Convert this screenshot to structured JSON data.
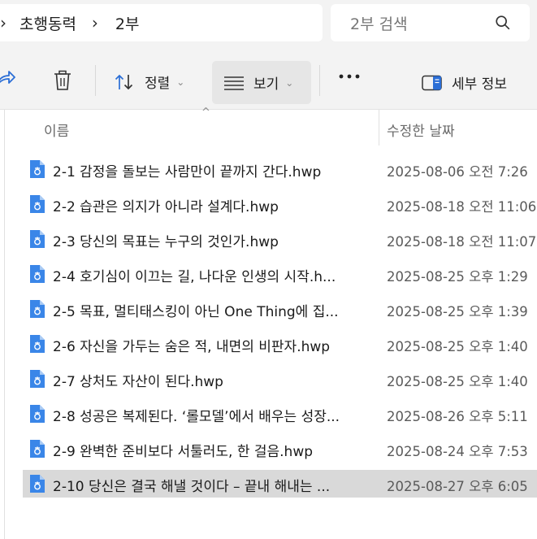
{
  "address": {
    "crumbs": [
      "초행동력",
      "2부"
    ]
  },
  "search": {
    "placeholder": "2부 검색"
  },
  "toolbar": {
    "sort_label": "정렬",
    "view_label": "보기",
    "details_label": "세부 정보"
  },
  "columns": {
    "name": "이름",
    "modified": "수정한 날짜"
  },
  "files": [
    {
      "name": "2-1 감정을 돌보는 사람만이 끝까지 간다.hwp",
      "modified": "2025-08-06 오전 7:26"
    },
    {
      "name": "2-2 습관은 의지가 아니라 설계다.hwp",
      "modified": "2025-08-18 오전 11:06"
    },
    {
      "name": "2-3 당신의 목표는 누구의 것인가.hwp",
      "modified": "2025-08-18 오전 11:07"
    },
    {
      "name": "2-4 호기심이 이끄는 길, 나다운 인생의 시작.h...",
      "modified": "2025-08-25 오후 1:29"
    },
    {
      "name": "2-5 목표, 멀티태스킹이 아닌 One Thing에 집...",
      "modified": "2025-08-25 오후 1:39"
    },
    {
      "name": "2-6 자신을 가두는 숨은 적, 내면의 비판자.hwp",
      "modified": "2025-08-25 오후 1:40"
    },
    {
      "name": "2-7 상처도 자산이 된다.hwp",
      "modified": "2025-08-25 오후 1:40"
    },
    {
      "name": "2-8 성공은 복제된다. ‘롤모델’에서 배우는 성장...",
      "modified": "2025-08-26 오후 5:11"
    },
    {
      "name": "2-9 완벽한 준비보다 서툴러도, 한 걸음.hwp",
      "modified": "2025-08-24 오후 7:53"
    },
    {
      "name": "2-10 당신은 결국 해낼 것이다 – 끝내 해내는 ...",
      "modified": "2025-08-27 오후 6:05"
    }
  ],
  "selected_index": 9,
  "colors": {
    "accent": "#1a73e8",
    "selected_row": "#d9d9d9"
  },
  "icons": [
    "chevron-right-icon",
    "search-icon",
    "share-icon",
    "trash-icon",
    "sort-icon",
    "view-list-icon",
    "more-icon",
    "details-pane-icon",
    "hwp-file-icon"
  ]
}
